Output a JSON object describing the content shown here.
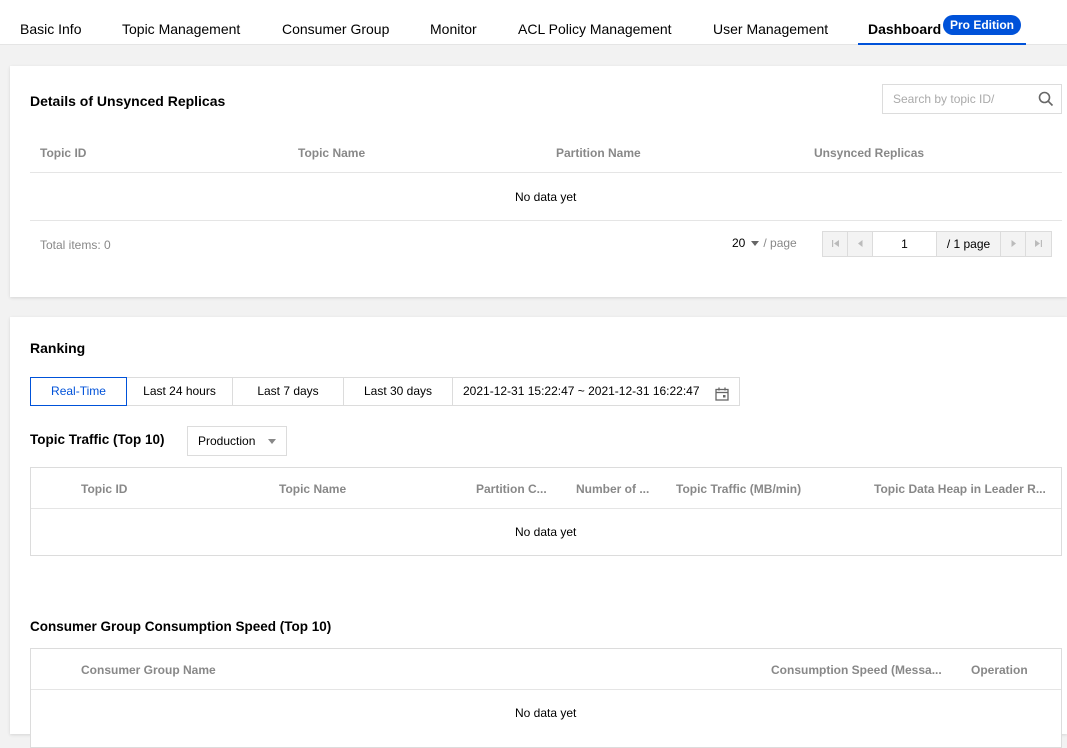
{
  "tabs": {
    "basic_info": "Basic Info",
    "topic_management": "Topic Management",
    "consumer_group": "Consumer Group",
    "monitor": "Monitor",
    "acl_policy": "ACL Policy Management",
    "user_management": "User Management",
    "dashboard": "Dashboard",
    "pro_badge": "Pro Edition"
  },
  "unsynced": {
    "title": "Details of Unsynced Replicas",
    "search_placeholder": "Search by topic ID/",
    "columns": [
      "Topic ID",
      "Topic Name",
      "Partition Name",
      "Unsynced Replicas"
    ],
    "empty_text": "No data yet",
    "total_label": "Total items:",
    "total_count": "0",
    "page_size": "20",
    "per_page_label": "/ page",
    "current_page": "1",
    "total_pages_label": "/ 1 page"
  },
  "ranking": {
    "title": "Ranking",
    "time_options": [
      "Real-Time",
      "Last 24 hours",
      "Last 7 days",
      "Last 30 days"
    ],
    "active_option": "Real-Time",
    "date_range": "2021-12-31 15:22:47 ~ 2021-12-31 16:22:47",
    "topic_traffic": {
      "title": "Topic Traffic (Top 10)",
      "env_select": "Production",
      "columns": [
        "Topic ID",
        "Topic Name",
        "Partition C...",
        "Number of ...",
        "Topic Traffic (MB/min)",
        "Topic Data Heap in Leader R..."
      ],
      "empty_text": "No data yet"
    },
    "consumer_speed": {
      "title": "Consumer Group Consumption Speed (Top 10)",
      "columns": [
        "Consumer Group Name",
        "Consumption Speed (Messa...",
        "Operation"
      ],
      "empty_text": "No data yet"
    }
  },
  "colors": {
    "accent": "#0052d9",
    "header_text": "#888888",
    "border": "#dcdcdc"
  },
  "icons": [
    "search-icon",
    "calendar-icon",
    "first-page-icon",
    "prev-page-icon",
    "next-page-icon",
    "last-page-icon",
    "chevron-down-icon"
  ]
}
